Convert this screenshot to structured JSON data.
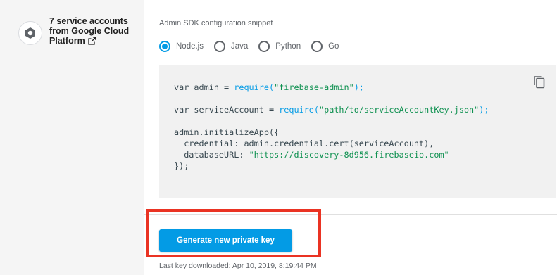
{
  "service_accounts": {
    "line1": "7 service accounts",
    "line2": "from Google Cloud",
    "line3": "Platform"
  },
  "snippet": {
    "title": "Admin SDK configuration snippet",
    "languages": [
      {
        "label": "Node.js",
        "selected": true
      },
      {
        "label": "Java",
        "selected": false
      },
      {
        "label": "Python",
        "selected": false
      },
      {
        "label": "Go",
        "selected": false
      }
    ],
    "code": {
      "l1_kw": "var admin = ",
      "l1_fn": "require(",
      "l1_str": "\"firebase-admin\"",
      "l1_end": ");",
      "l2_kw": "var serviceAccount = ",
      "l2_fn": "require(",
      "l2_str": "\"path/to/serviceAccountKey.json\"",
      "l2_end": ");",
      "l3": "admin.initializeApp({",
      "l4_key": "  credential",
      "l4_rest": ": admin.credential.cert(serviceAccount),",
      "l5_key": "  databaseURL",
      "l5_colon": ": ",
      "l5_str": "\"https://discovery-8d956.firebaseio.com\"",
      "l6": "});"
    }
  },
  "actions": {
    "generate_label": "Generate new private key",
    "last_downloaded": "Last key downloaded: Apr 10, 2019, 8:19:44 PM"
  },
  "colors": {
    "accent": "#039be5",
    "highlight": "#ea3323",
    "code_background": "#f1f1f1"
  }
}
